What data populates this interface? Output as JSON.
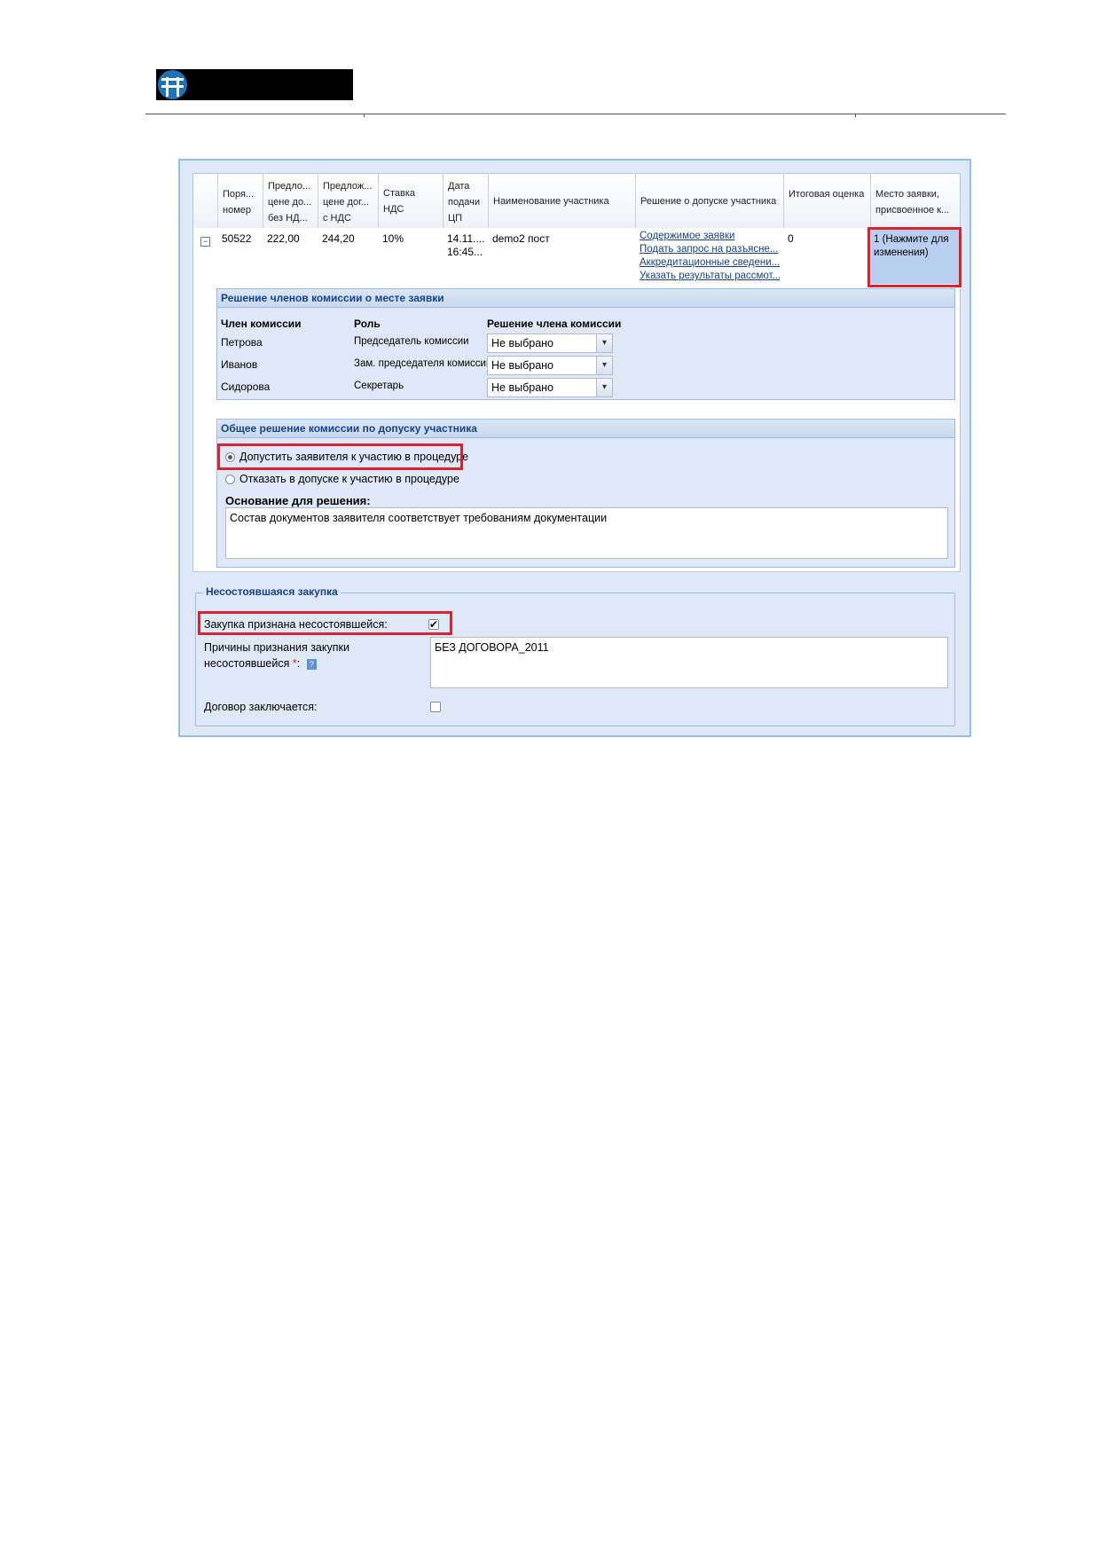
{
  "grid": {
    "columns": [
      "Поря... номер",
      "Предло... цене до... без НД...",
      "Предлож... цене дог... с НДС",
      "Ставка НДС",
      "Дата подачи ЦП",
      "Наименование участника",
      "Решение о допуске участника",
      "Итоговая оценка",
      "Место заявки, присвоенное к..."
    ],
    "row": {
      "number": "50522",
      "price_no_vat": "222,00",
      "price_vat": "244,20",
      "vat_rate": "10%",
      "date": "14.11....",
      "time": "16:45...",
      "participant": "demo2 пост",
      "links": [
        "Содержимое заявки",
        "Подать запрос на разъясне...",
        "Аккредитационные сведени...",
        "Указать результаты рассмот..."
      ],
      "score": "0",
      "place": "1 (Нажмите для изменения)"
    }
  },
  "members_panel": {
    "title": "Решение членов комиссии о месте заявки",
    "headers": {
      "member": "Член комиссии",
      "role": "Роль",
      "decision": "Решение члена комиссии"
    },
    "rows": [
      {
        "member": "Петрова",
        "role": "Председатель комиссии",
        "decision": "Не выбрано"
      },
      {
        "member": "Иванов",
        "role": "Зам. председателя комиссии",
        "decision": "Не выбрано"
      },
      {
        "member": "Сидорова",
        "role": "Секретарь",
        "decision": "Не выбрано"
      }
    ]
  },
  "admission_panel": {
    "title": "Общее решение комиссии по допуску участника",
    "options": [
      {
        "label": "Допустить заявителя к участию в процедуре",
        "selected": true
      },
      {
        "label": "Отказать в допуске к участию в процедуре",
        "selected": false
      }
    ],
    "basis_label": "Основание для решения:",
    "basis_value": "Состав документов заявителя соответствует требованиям документации"
  },
  "failed_purchase": {
    "legend": "Несостоявшаяся закупка",
    "recognized_label": "Закупка признана несостоявшейся:",
    "recognized_checked": true,
    "reasons_label_1": "Причины признания закупки",
    "reasons_label_2": "несостоявшейся",
    "required_mark": "*",
    "reasons_value": "БЕЗ ДОГОВОРА_2011",
    "contract_label": "Договор заключается:",
    "contract_checked": false
  }
}
